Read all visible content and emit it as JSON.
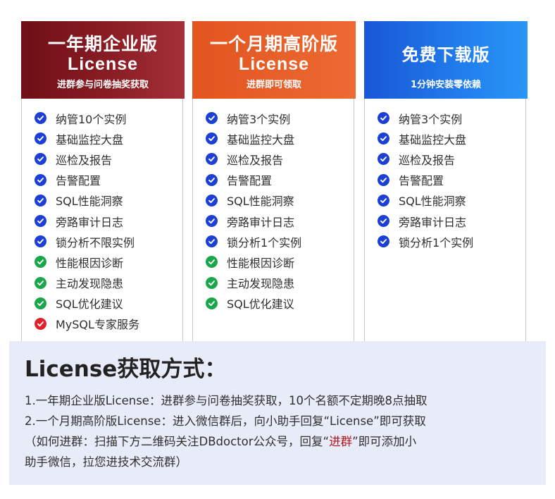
{
  "colors": {
    "enterprise_header": "#7a141b",
    "monthly_header": "#e85e29",
    "free_header": "#1e6fe6",
    "check_blue": "#1c3fd6",
    "check_green": "#1aa64a",
    "check_red": "#e0222c",
    "highlight_red": "#b3161f",
    "info_background": "#e8ebf8"
  },
  "plans": [
    {
      "title": "一年期企业版",
      "subtitle": "License",
      "note": "进群参与问卷抽奖获取",
      "features": [
        {
          "label": "纳管10个实例",
          "icon": "check-circle-blue-icon"
        },
        {
          "label": "基础监控大盘",
          "icon": "check-circle-blue-icon"
        },
        {
          "label": "巡检及报告",
          "icon": "check-circle-blue-icon"
        },
        {
          "label": "告警配置",
          "icon": "check-circle-blue-icon"
        },
        {
          "label": "SQL性能洞察",
          "icon": "check-circle-blue-icon"
        },
        {
          "label": "旁路审计日志",
          "icon": "check-circle-blue-icon"
        },
        {
          "label": "锁分析不限实例",
          "icon": "check-circle-blue-icon"
        },
        {
          "label": "性能根因诊断",
          "icon": "check-circle-green-icon"
        },
        {
          "label": "主动发现隐患",
          "icon": "check-circle-green-icon"
        },
        {
          "label": "SQL优化建议",
          "icon": "check-circle-green-icon"
        },
        {
          "label": "MySQL专家服务",
          "icon": "check-circle-red-icon"
        }
      ]
    },
    {
      "title": "一个月期高阶版",
      "subtitle": "License",
      "note": "进群即可领取",
      "features": [
        {
          "label": "纳管3个实例",
          "icon": "check-circle-blue-icon"
        },
        {
          "label": "基础监控大盘",
          "icon": "check-circle-blue-icon"
        },
        {
          "label": "巡检及报告",
          "icon": "check-circle-blue-icon"
        },
        {
          "label": "告警配置",
          "icon": "check-circle-blue-icon"
        },
        {
          "label": "SQL性能洞察",
          "icon": "check-circle-blue-icon"
        },
        {
          "label": "旁路审计日志",
          "icon": "check-circle-blue-icon"
        },
        {
          "label": "锁分析1个实例",
          "icon": "check-circle-blue-icon"
        },
        {
          "label": "性能根因诊断",
          "icon": "check-circle-green-icon"
        },
        {
          "label": "主动发现隐患",
          "icon": "check-circle-green-icon"
        },
        {
          "label": "SQL优化建议",
          "icon": "check-circle-green-icon"
        }
      ]
    },
    {
      "title": "免费下载版",
      "subtitle": "",
      "note": "1分钟安装零依赖",
      "features": [
        {
          "label": "纳管3个实例",
          "icon": "check-circle-blue-icon"
        },
        {
          "label": "基础监控大盘",
          "icon": "check-circle-blue-icon"
        },
        {
          "label": "巡检及报告",
          "icon": "check-circle-blue-icon"
        },
        {
          "label": "告警配置",
          "icon": "check-circle-blue-icon"
        },
        {
          "label": "SQL性能洞察",
          "icon": "check-circle-blue-icon"
        },
        {
          "label": "旁路审计日志",
          "icon": "check-circle-blue-icon"
        },
        {
          "label": "锁分析1个实例",
          "icon": "check-circle-blue-icon"
        }
      ]
    }
  ],
  "info": {
    "title": "License获取方式：",
    "line1": "1.一年期企业版License：进群参与问卷抽奖获取，10个名额不定期晚8点抽取",
    "line2": "2.一个月期高阶版License：进入微信群后，向小助手回复“License”即可获取",
    "line3_before": "（如何进群：扫描下方二维码关注DBdoctor公众号，回复“",
    "line3_highlight": "进群",
    "line3_after": "”即可添加小",
    "line4": "助手微信，拉您进技术交流群）"
  }
}
